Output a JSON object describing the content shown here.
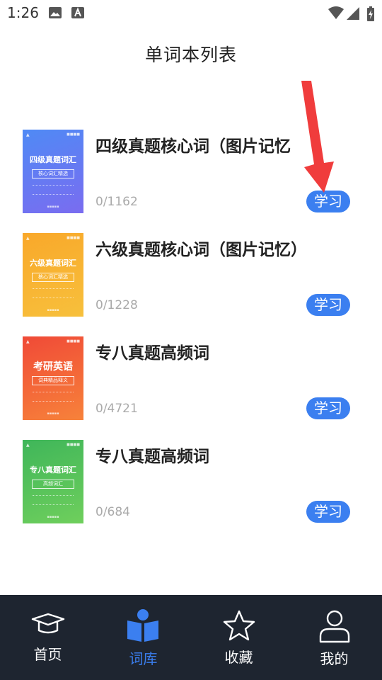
{
  "status_bar": {
    "time": "1:26"
  },
  "title": "单词本列表",
  "books": [
    {
      "name": "四级真题核心词（图片记忆",
      "progress": "0/1162",
      "action": "学习",
      "cover": {
        "title": "四级真题词汇",
        "subtitle": "核心词汇精选",
        "colors": [
          "#4f8af5",
          "#7a6cf0"
        ]
      }
    },
    {
      "name": "六级真题核心词（图片记忆）",
      "progress": "0/1228",
      "action": "学习",
      "cover": {
        "title": "六级真题词汇",
        "subtitle": "核心词汇精选",
        "colors": [
          "#f9a82a",
          "#f7c03c"
        ]
      }
    },
    {
      "name": "专八真题高频词",
      "progress": "0/4721",
      "action": "学习",
      "cover": {
        "title": "考研英语",
        "subtitle": "词典精品释义",
        "colors": [
          "#f04a37",
          "#f7823a"
        ]
      }
    },
    {
      "name": "专八真题高频词",
      "progress": "0/684",
      "action": "学习",
      "cover": {
        "title": "专八真题词汇",
        "subtitle": "高频词汇",
        "colors": [
          "#3fb65a",
          "#6fcf5c"
        ]
      }
    }
  ],
  "nav": [
    {
      "label": "首页",
      "icon": "graduation-cap-icon",
      "active": false
    },
    {
      "label": "词库",
      "icon": "reader-book-icon",
      "active": true
    },
    {
      "label": "收藏",
      "icon": "star-icon",
      "active": false
    },
    {
      "label": "我的",
      "icon": "user-icon",
      "active": false
    }
  ],
  "colors": {
    "accent": "#3b7ff0",
    "nav_bg": "#1e2530",
    "arrow": "#f03c3c"
  }
}
